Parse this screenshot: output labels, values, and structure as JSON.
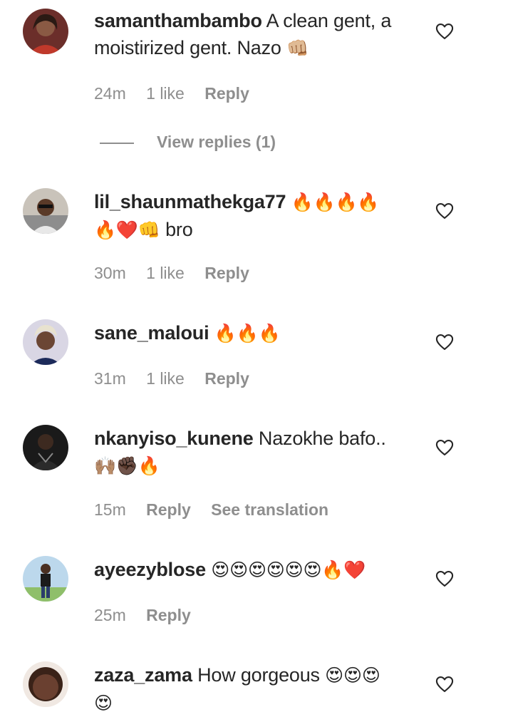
{
  "colors": {
    "text": "#262626",
    "secondary": "#8e8e8e",
    "background": "#ffffff"
  },
  "comments": [
    {
      "username": "samanthambambo",
      "text": "A clean gent, a moistirized gent. Nazo",
      "emoji": "👊🏼",
      "time": "24m",
      "likes": "1 like",
      "reply": "Reply",
      "view_replies": "View replies (1)",
      "like_icon": "heart-outline-icon"
    },
    {
      "username": "lil_shaunmathekga77",
      "emoji": "🔥🔥🔥🔥",
      "emoji2": "🔥❤️👊",
      "text": "bro",
      "time": "30m",
      "likes": "1 like",
      "reply": "Reply",
      "like_icon": "heart-outline-icon"
    },
    {
      "username": "sane_maloui",
      "emoji": "🔥🔥🔥",
      "time": "31m",
      "likes": "1 like",
      "reply": "Reply",
      "like_icon": "heart-outline-icon"
    },
    {
      "username": "nkanyiso_kunene",
      "text": "Nazokhe bafo..",
      "emoji": "🙌🏽✊🏿🔥",
      "time": "15m",
      "reply": "Reply",
      "translation": "See translation",
      "like_icon": "heart-outline-icon"
    },
    {
      "username": "ayeezyblose",
      "emoji": "😍😍😍😍😍😍🔥❤️",
      "time": "25m",
      "reply": "Reply",
      "like_icon": "heart-outline-icon"
    },
    {
      "username": "zaza_zama",
      "text": "How gorgeous",
      "emoji": "😍😍😍",
      "emoji2": "😍",
      "like_icon": "heart-outline-icon"
    }
  ]
}
